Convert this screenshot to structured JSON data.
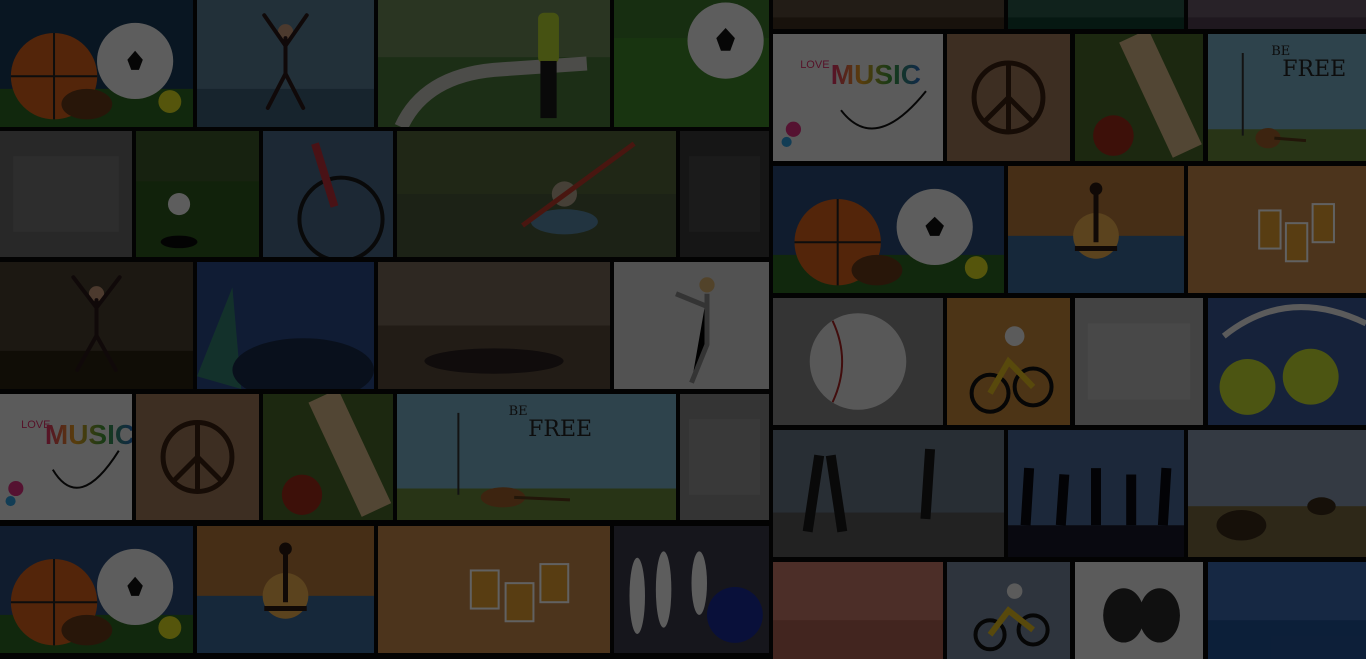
{
  "collage": {
    "overlay_color": "#000000",
    "tiles": [
      {
        "name": "sports-balls-tile",
        "kind": "balls",
        "bg": "#1a3a5a"
      },
      {
        "name": "jumping-woman-tile",
        "kind": "person",
        "bg": "#5b7e95"
      },
      {
        "name": "runner-path-tile",
        "kind": "runner",
        "bg": "#6f8b5a"
      },
      {
        "name": "soccer-ball-grass-tile",
        "kind": "soccer",
        "bg": "#3d7a2e"
      },
      {
        "name": "gym-bw-tile",
        "kind": "bw",
        "bg": "#6a6a6a"
      },
      {
        "name": "golf-ball-tile",
        "kind": "golf",
        "bg": "#3d5a2a"
      },
      {
        "name": "cyclist-tile",
        "kind": "cyclist",
        "bg": "#4a6a8a"
      },
      {
        "name": "kayak-tile",
        "kind": "kayak",
        "bg": "#55663a"
      },
      {
        "name": "boot-tile",
        "kind": "bw",
        "bg": "#3a3a3a"
      },
      {
        "name": "girl-forest-tile",
        "kind": "person",
        "bg": "#4a4030"
      },
      {
        "name": "concert-lights-tile",
        "kind": "concert",
        "bg": "#2a4a8a"
      },
      {
        "name": "lying-girl-tile",
        "kind": "lying",
        "bg": "#7a6a5a"
      },
      {
        "name": "dancer-tile",
        "kind": "dancer",
        "bg": "#d8d8d8"
      },
      {
        "name": "love-music-tile",
        "kind": "music",
        "bg": "#f0f0f0"
      },
      {
        "name": "peace-hands-tile",
        "kind": "hands",
        "bg": "#a07a5a"
      },
      {
        "name": "cricket-tile",
        "kind": "cricket",
        "bg": "#4a6a2a"
      },
      {
        "name": "be-free-tile",
        "kind": "befree",
        "bg": "#7ab0c8"
      },
      {
        "name": "ice-tile",
        "kind": "bw",
        "bg": "#8a8a8a"
      },
      {
        "name": "sports-balls-2-tile",
        "kind": "balls",
        "bg": "#2a4a7a"
      },
      {
        "name": "yoga-sunset-tile",
        "kind": "yoga",
        "bg": "#b87a3a"
      },
      {
        "name": "beer-toast-tile",
        "kind": "beer",
        "bg": "#c88a4a"
      },
      {
        "name": "bowling-tile",
        "kind": "bowling",
        "bg": "#3a3a4a"
      },
      {
        "name": "top-strip-1-tile",
        "kind": "plain",
        "bg": "#5a4a3a"
      },
      {
        "name": "top-strip-2-tile",
        "kind": "plain",
        "bg": "#2a5a4a"
      },
      {
        "name": "top-strip-3-tile",
        "kind": "plain",
        "bg": "#6a5a6a"
      },
      {
        "name": "love-music-2-tile",
        "kind": "music",
        "bg": "#f0f0f0"
      },
      {
        "name": "peace-hands-2-tile",
        "kind": "hands",
        "bg": "#a07a5a"
      },
      {
        "name": "cricket-2-tile",
        "kind": "cricket",
        "bg": "#4a6a2a"
      },
      {
        "name": "be-free-2-tile",
        "kind": "befree",
        "bg": "#7ab0c8"
      },
      {
        "name": "sports-balls-3-tile",
        "kind": "balls",
        "bg": "#2a4a7a"
      },
      {
        "name": "yoga-sunset-2-tile",
        "kind": "yoga",
        "bg": "#b87a3a"
      },
      {
        "name": "beer-toast-2-tile",
        "kind": "beer",
        "bg": "#c88a4a"
      },
      {
        "name": "baseball-tile",
        "kind": "baseball",
        "bg": "#8a8a8a"
      },
      {
        "name": "motocross-tile",
        "kind": "moto",
        "bg": "#c8883a"
      },
      {
        "name": "headphones-tile",
        "kind": "bw",
        "bg": "#b0b0b0"
      },
      {
        "name": "tennis-balls-tile",
        "kind": "tennis",
        "bg": "#3a5a9a"
      },
      {
        "name": "runners-legs-tile",
        "kind": "runners",
        "bg": "#6a7a8a"
      },
      {
        "name": "jumping-silhouettes-tile",
        "kind": "silhouettes",
        "bg": "#4a6a9a"
      },
      {
        "name": "horse-riders-tile",
        "kind": "horses",
        "bg": "#8a9ab0"
      },
      {
        "name": "drumstick-tile",
        "kind": "plain",
        "bg": "#c87a6a"
      },
      {
        "name": "atv-tile",
        "kind": "moto",
        "bg": "#7a8aa0"
      },
      {
        "name": "theatre-masks-tile",
        "kind": "masks",
        "bg": "#f0f0f0"
      },
      {
        "name": "diver-tile",
        "kind": "plain",
        "bg": "#3a6ab0"
      }
    ]
  },
  "texts": {
    "love_music_love": "LOVE",
    "love_music_music": "MUSIC",
    "be_free_be": "BE",
    "be_free_free": "FREE"
  }
}
